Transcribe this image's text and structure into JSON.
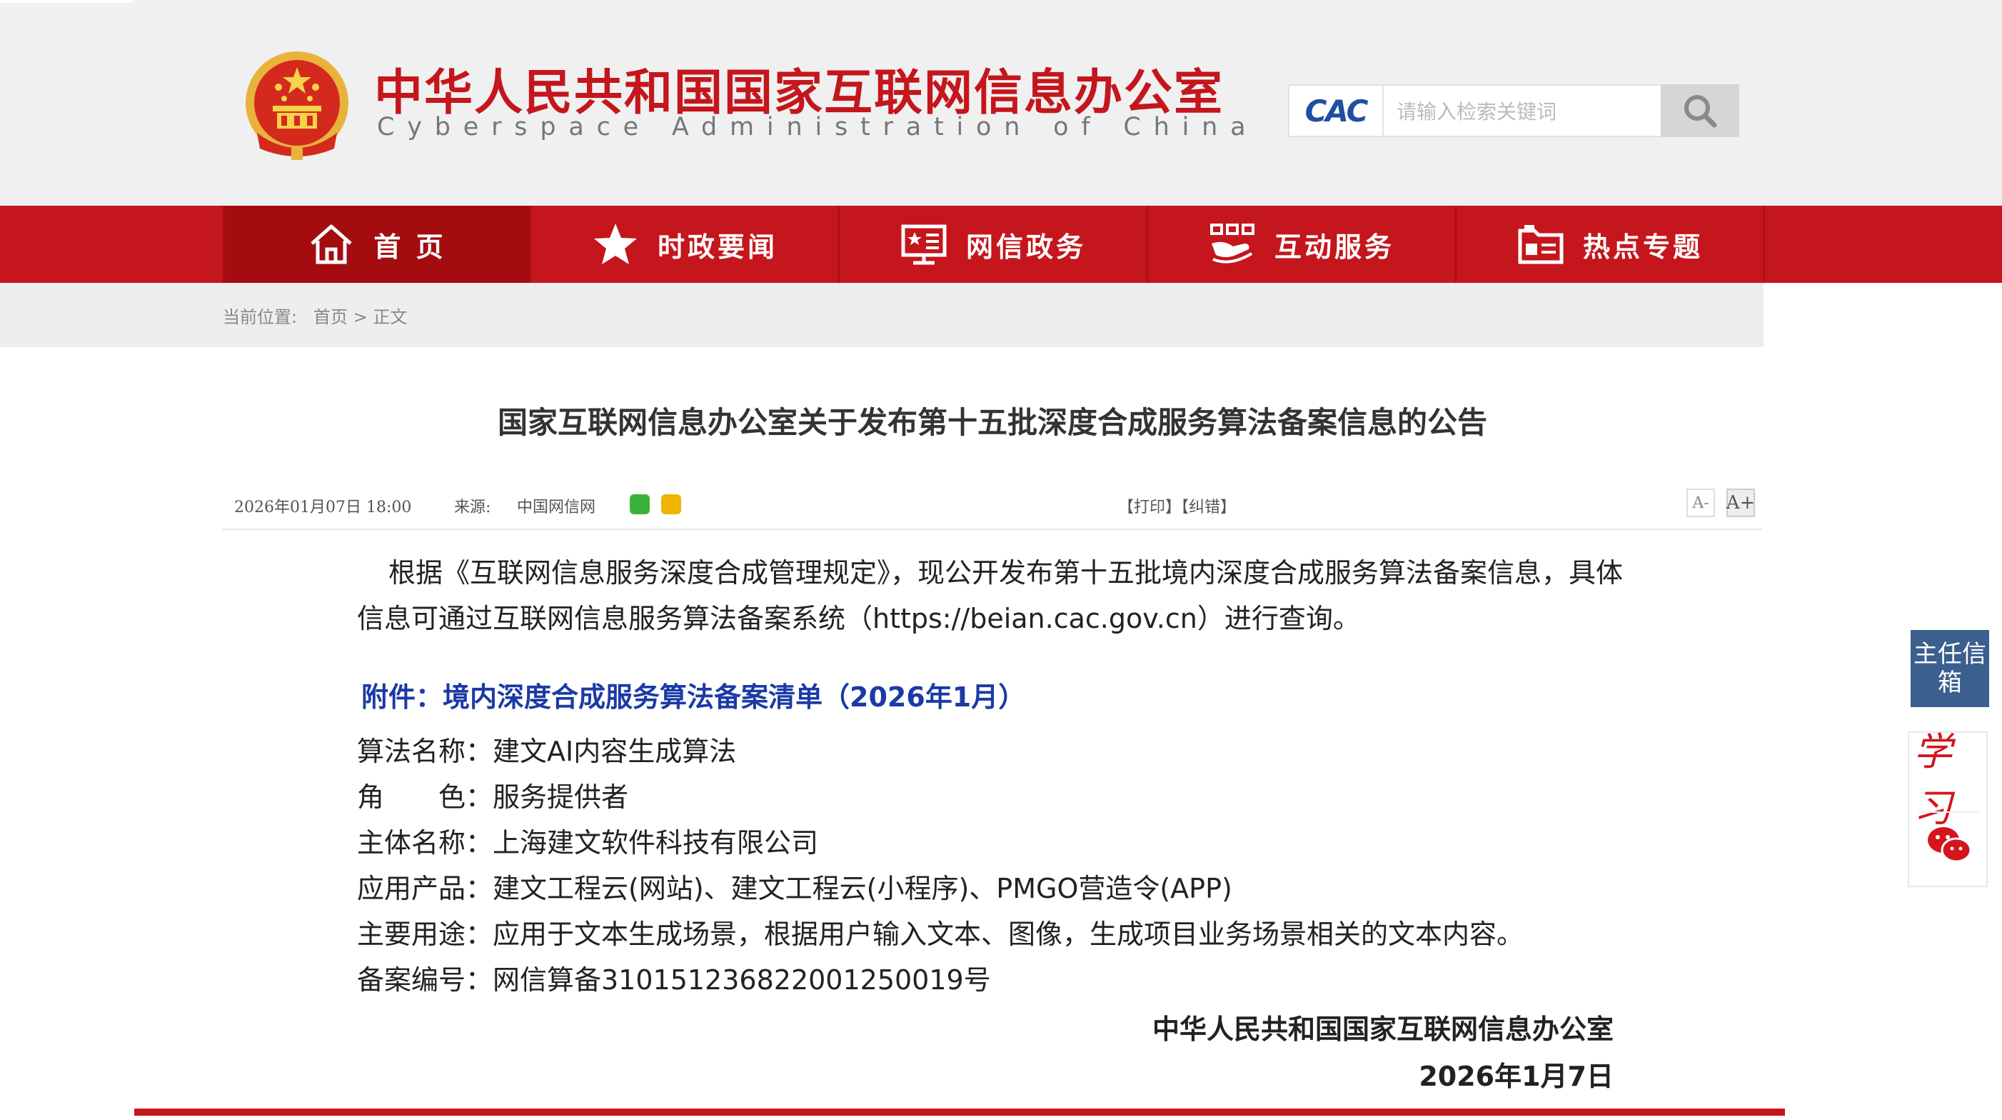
{
  "header": {
    "title": "中华人民共和国国家互联网信息办公室",
    "subtitle": "Cyberspace Administration of China",
    "cac_logo": "CAC",
    "search": {
      "placeholder": "请输入检索关键词",
      "icon": "search-icon"
    },
    "emblem": "national-emblem"
  },
  "nav": {
    "items": [
      {
        "label": "首 页",
        "icon": "home-icon",
        "active": true
      },
      {
        "label": "时政要闻",
        "icon": "star-icon"
      },
      {
        "label": "网信政务",
        "icon": "screen-icon"
      },
      {
        "label": "互动服务",
        "icon": "handshake-icon"
      },
      {
        "label": "热点专题",
        "icon": "folder-icon"
      }
    ]
  },
  "breadcrumb": {
    "prefix": "当前位置:",
    "home": "首页",
    "sep": ">",
    "current": "正文"
  },
  "article": {
    "title": "国家互联网信息办公室关于发布第十五批深度合成服务算法备案信息的公告",
    "meta": {
      "date": "2026年01月07日  18:00",
      "source_label": "来源:",
      "source": "中国网信网",
      "print": "【打印】",
      "correct": "【纠错】",
      "font_small": "A-",
      "font_large": "A+"
    },
    "para1": "根据《互联网信息服务深度合成管理规定》，现公开发布第十五批境内深度合成服务算法备案信息，具体信息可通过互联网信息服务算法备案系统（https://beian.cac.gov.cn）进行查询。",
    "attachment_title": "附件：境内深度合成服务算法备案清单（2026年1月）",
    "fields": [
      {
        "text": "算法名称：建文AI内容生成算法"
      },
      {
        "text": "角　　色：服务提供者"
      },
      {
        "text": "主体名称：上海建文软件科技有限公司"
      },
      {
        "text": "应用产品：建文工程云(网站)、建文工程云(小程序)、PMGO营造令(APP)"
      },
      {
        "text": "主要用途：应用于文本生成场景，根据用户输入文本、图像，生成项目业务场景相关的文本内容。"
      },
      {
        "text": "备案编号：网信算备310151236822001250019号"
      }
    ],
    "signature_org": "中华人民共和国国家互联网信息办公室",
    "signature_date": "2026年1月7日"
  },
  "sidebar": {
    "mailbox_label": "主任信箱",
    "xuexi_label": "学习",
    "wechat_icon": "wechat-icon"
  },
  "colors": {
    "brand_red": "#c4161c",
    "link_blue": "#1b3aa5",
    "mailbox_blue": "#3b5f8e"
  }
}
